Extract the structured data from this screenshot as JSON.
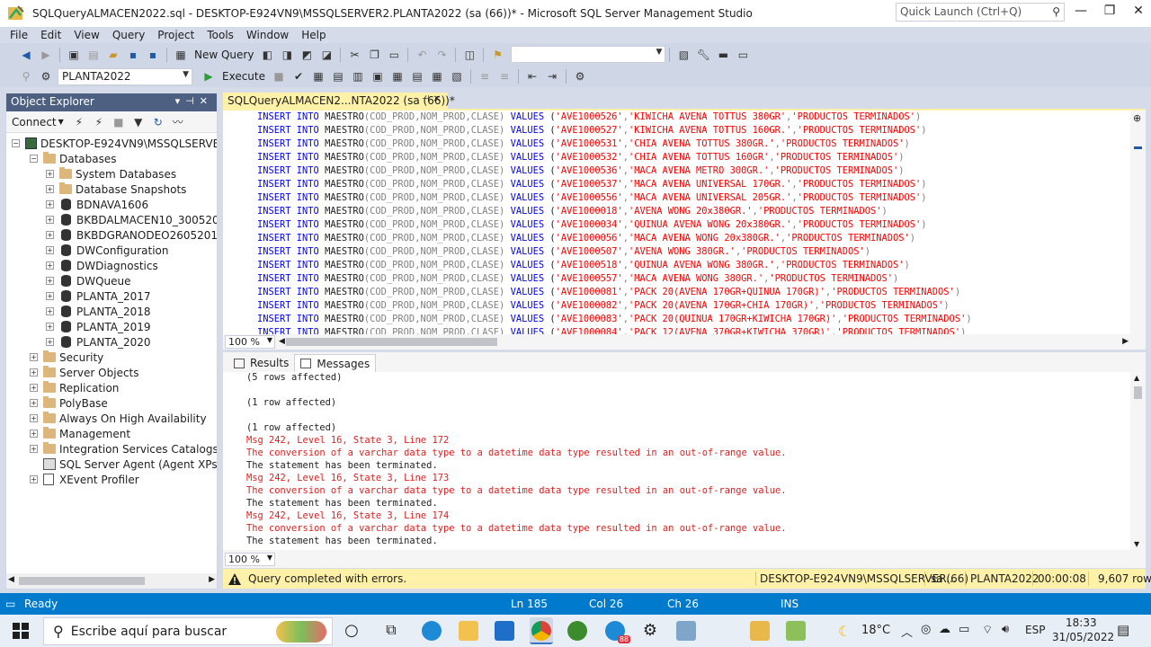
{
  "window": {
    "title": "SQLQueryALMACEN2022.sql - DESKTOP-E924VN9\\MSSQLSERVER2.PLANTA2022 (sa (66))* - Microsoft SQL Server Management Studio",
    "quick_launch_placeholder": "Quick Launch (Ctrl+Q)"
  },
  "menu": [
    "File",
    "Edit",
    "View",
    "Query",
    "Project",
    "Tools",
    "Window",
    "Help"
  ],
  "toolbar": {
    "new_query": "New Query",
    "database": "PLANTA2022",
    "execute": "Execute"
  },
  "object_explorer": {
    "title": "Object Explorer",
    "connect": "Connect",
    "server": "DESKTOP-E924VN9\\MSSQLSERVER2 (SC",
    "databases": "Databases",
    "db_items": [
      "System Databases",
      "Database Snapshots",
      "BDNAVA1606",
      "BKBDALMACEN10_30052011",
      "BKBDGRANODEO26052011",
      "DWConfiguration",
      "DWDiagnostics",
      "DWQueue",
      "PLANTA_2017",
      "PLANTA_2018",
      "PLANTA_2019",
      "PLANTA_2020"
    ],
    "top_items": [
      "Security",
      "Server Objects",
      "Replication",
      "PolyBase",
      "Always On High Availability",
      "Management",
      "Integration Services Catalogs",
      "SQL Server Agent (Agent XPs disabl",
      "XEvent Profiler"
    ]
  },
  "editor": {
    "tab_label": "SQLQueryALMACEN2...NTA2022 (sa (66))*",
    "insert_prefix": "INSERT INTO",
    "table_name": "MAESTRO",
    "columns": "(COD_PROD,NOM_PROD,CLASE)",
    "values_kw": "VALUES",
    "lines": [
      {
        "code": "'AVE1000526'",
        "name": "'KIWICHA AVENA TOTTUS 380GR'",
        "class": "'PRODUCTOS TERMINADOS'"
      },
      {
        "code": "'AVE1000527'",
        "name": "'KIWICHA AVENA TOTTUS 160GR.'",
        "class": "'PRODUCTOS TERMINADOS'"
      },
      {
        "code": "'AVE1000531'",
        "name": "'CHIA AVENA TOTTUS 380GR.'",
        "class": "'PRODUCTOS TERMINADOS'"
      },
      {
        "code": "'AVE1000532'",
        "name": "'CHIA AVENA TOTTUS 160GR'",
        "class": "'PRODUCTOS TERMINADOS'"
      },
      {
        "code": "'AVE1000536'",
        "name": "'MACA AVENA METRO 300GR.'",
        "class": "'PRODUCTOS TERMINADOS'"
      },
      {
        "code": "'AVE1000537'",
        "name": "'MACA AVENA UNIVERSAL 170GR.'",
        "class": "'PRODUCTOS TERMINADOS'"
      },
      {
        "code": "'AVE1000556'",
        "name": "'MACA AVENA UNIVERSAL 205GR.'",
        "class": "'PRODUCTOS TERMINADOS'"
      },
      {
        "code": "'AVE1000018'",
        "name": "'AVENA WONG 20x380GR.'",
        "class": "'PRODUCTOS TERMINADOS'"
      },
      {
        "code": "'AVE1000034'",
        "name": "'QUINUA AVENA WONG 20x380GR.'",
        "class": "'PRODUCTOS TERMINADOS'"
      },
      {
        "code": "'AVE1000056'",
        "name": "'MACA AVENA WONG 20x380GR.'",
        "class": "'PRODUCTOS TERMINADOS'"
      },
      {
        "code": "'AVE1000507'",
        "name": "'AVENA WONG 380GR.'",
        "class": "'PRODUCTOS TERMINADOS'"
      },
      {
        "code": "'AVE1000518'",
        "name": "'QUINUA AVENA WONG 380GR.'",
        "class": "'PRODUCTOS TERMINADOS'"
      },
      {
        "code": "'AVE1000557'",
        "name": "'MACA AVENA WONG 380GR.'",
        "class": "'PRODUCTOS TERMINADOS'"
      },
      {
        "code": "'AVE1000081'",
        "name": "'PACK 20(AVENA 170GR+QUINUA 170GR)'",
        "class": "'PRODUCTOS TERMINADOS'"
      },
      {
        "code": "'AVE1000082'",
        "name": "'PACK 20(AVENA 170GR+CHIA 170GR)'",
        "class": "'PRODUCTOS TERMINADOS'"
      },
      {
        "code": "'AVE1000083'",
        "name": "'PACK 20(QUINUA 170GR+KIWICHA 170GR)'",
        "class": "'PRODUCTOS TERMINADOS'"
      },
      {
        "code": "'AVE1000084'",
        "name": "'PACK 12(AVENA 370GR+KIWICHA 370GR)'",
        "class": "'PRODUCTOS TERMINADOS'"
      }
    ],
    "zoom": "100 %"
  },
  "results": {
    "tab_results": "Results",
    "tab_messages": "Messages",
    "messages": [
      {
        "text": "(5 rows affected)",
        "kind": "black"
      },
      {
        "text": "",
        "kind": "black"
      },
      {
        "text": "(1 row affected)",
        "kind": "black"
      },
      {
        "text": "",
        "kind": "black"
      },
      {
        "text": "(1 row affected)",
        "kind": "black"
      },
      {
        "text": "Msg 242, Level 16, State 3, Line 172",
        "kind": "red"
      },
      {
        "text": "The conversion of a varchar data type to a datetime data type resulted in an out-of-range value.",
        "kind": "red"
      },
      {
        "text": "The statement has been terminated.",
        "kind": "black"
      },
      {
        "text": "Msg 242, Level 16, State 3, Line 173",
        "kind": "red"
      },
      {
        "text": "The conversion of a varchar data type to a datetime data type resulted in an out-of-range value.",
        "kind": "red"
      },
      {
        "text": "The statement has been terminated.",
        "kind": "black"
      },
      {
        "text": "Msg 242, Level 16, State 3, Line 174",
        "kind": "red"
      },
      {
        "text": "The conversion of a varchar data type to a datetime data type resulted in an out-of-range value.",
        "kind": "red"
      },
      {
        "text": "The statement has been terminated.",
        "kind": "black"
      }
    ],
    "zoom": "100 %"
  },
  "query_status": {
    "message": "Query completed with errors.",
    "server": "DESKTOP-E924VN9\\MSSQLSERVER...",
    "user": "sa (66)",
    "database": "PLANTA2022",
    "elapsed": "00:00:08",
    "rows": "9,607 rows"
  },
  "app_status": {
    "ready": "Ready",
    "ln": "Ln 185",
    "col": "Col 26",
    "ch": "Ch 26",
    "mode": "INS"
  },
  "taskbar": {
    "search_placeholder": "Escribe aquí para buscar",
    "temperature": "18°C",
    "language": "ESP",
    "time": "18:33",
    "date": "31/05/2022",
    "badge": "88"
  },
  "colors": {
    "keyword": "#0000ff",
    "string": "#ff0000",
    "error": "#e01f1f",
    "status_blue": "#007acc",
    "tab_yellow": "#fff1a8",
    "oe_header": "#4d6082"
  }
}
